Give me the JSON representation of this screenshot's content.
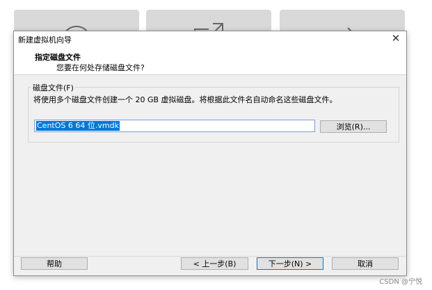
{
  "dialog": {
    "title": "新建虚拟机向导",
    "header_title": "指定磁盘文件",
    "header_subtitle": "您要在何处存储磁盘文件?"
  },
  "disk_group": {
    "legend": "磁盘文件(F)",
    "description": "将使用多个磁盘文件创建一个 20 GB 虚拟磁盘。将根据此文件名自动命名这些磁盘文件。",
    "file_value": "CentOS 6 64 位.vmdk",
    "browse_label": "浏览(R)..."
  },
  "buttons": {
    "help": "帮助",
    "prev": "< 上一步(B)",
    "next": "下一步(N) >",
    "cancel": "取消"
  },
  "watermark": "CSDN @宁悦"
}
